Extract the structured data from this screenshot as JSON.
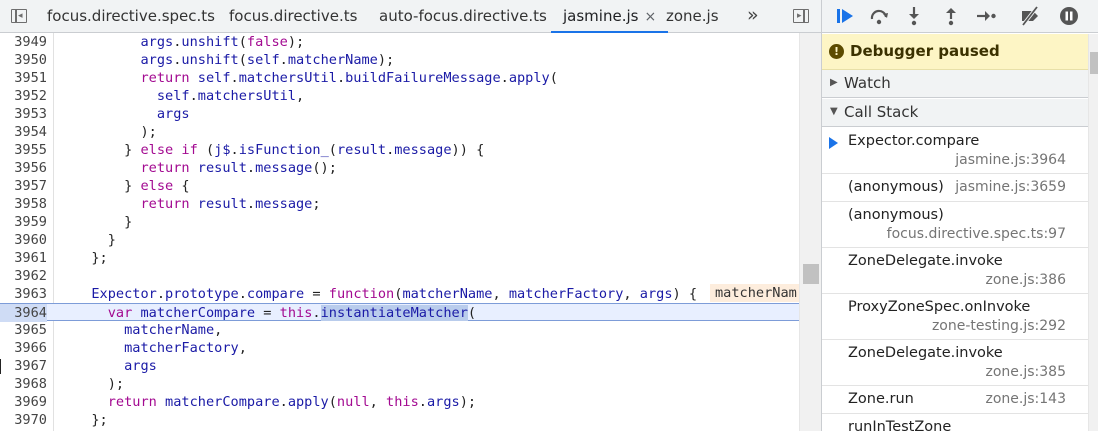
{
  "editor": {
    "tabs": [
      {
        "label": "focus.directive.spec.ts",
        "active": false
      },
      {
        "label": "focus.directive.ts",
        "active": false
      },
      {
        "label": "auto-focus.directive.ts",
        "active": false
      },
      {
        "label": "jasmine.js",
        "active": true,
        "close": "×"
      },
      {
        "label": "zone.js",
        "active": false
      }
    ],
    "overflow_chevron": "»",
    "current_line": "3964",
    "inline_value": "matcherNam",
    "lines": [
      {
        "n": "3949",
        "code": "        args.unshift(false);"
      },
      {
        "n": "3950",
        "code": "        args.unshift(self.matcherName);"
      },
      {
        "n": "3951",
        "code": "        return self.matchersUtil.buildFailureMessage.apply("
      },
      {
        "n": "3952",
        "code": "          self.matchersUtil,"
      },
      {
        "n": "3953",
        "code": "          args"
      },
      {
        "n": "3954",
        "code": "        );"
      },
      {
        "n": "3955",
        "code": "      } else if (j$.isFunction_(result.message)) {"
      },
      {
        "n": "3956",
        "code": "        return result.message();"
      },
      {
        "n": "3957",
        "code": "      } else {"
      },
      {
        "n": "3958",
        "code": "        return result.message;"
      },
      {
        "n": "3959",
        "code": "      }"
      },
      {
        "n": "3960",
        "code": "    }"
      },
      {
        "n": "3961",
        "code": "  };"
      },
      {
        "n": "3962",
        "code": ""
      },
      {
        "n": "3963",
        "code": "  Expector.prototype.compare = function(matcherName, matcherFactory, args) {"
      },
      {
        "n": "3964",
        "code": "    var matcherCompare = this.instantiateMatcher("
      },
      {
        "n": "3965",
        "code": "      matcherName,"
      },
      {
        "n": "3966",
        "code": "      matcherFactory,"
      },
      {
        "n": "3967",
        "code": "      args"
      },
      {
        "n": "3968",
        "code": "    );"
      },
      {
        "n": "3969",
        "code": "    return matcherCompare.apply(null, this.args);"
      },
      {
        "n": "3970",
        "code": "  };"
      }
    ]
  },
  "debugger": {
    "toolbar_icons": [
      "resume-icon",
      "step-over-icon",
      "step-into-icon",
      "step-out-icon",
      "step-icon",
      "deactivate-breakpoints-icon",
      "pause-on-exceptions-icon"
    ],
    "paused_banner": "Debugger paused",
    "watch_label": "Watch",
    "callstack_label": "Call Stack",
    "frames": [
      {
        "fn": "Expector.compare",
        "loc": "jasmine.js:3964",
        "current": true
      },
      {
        "fn": "(anonymous)",
        "loc": "jasmine.js:3659"
      },
      {
        "fn": "(anonymous)",
        "loc": "focus.directive.spec.ts:97"
      },
      {
        "fn": "ZoneDelegate.invoke",
        "loc": "zone.js:386"
      },
      {
        "fn": "ProxyZoneSpec.onInvoke",
        "loc": "zone-testing.js:292"
      },
      {
        "fn": "ZoneDelegate.invoke",
        "loc": "zone.js:385"
      },
      {
        "fn": "Zone.run",
        "loc": "zone.js:143"
      },
      {
        "fn": "runInTestZone",
        "loc": ""
      }
    ]
  },
  "colors": {
    "accent": "#1a73e8",
    "paused_bg": "#fdf5c5",
    "keyword": "#a30a91",
    "identifier": "#1a1aa6",
    "current_line_bg": "#e8efff"
  }
}
